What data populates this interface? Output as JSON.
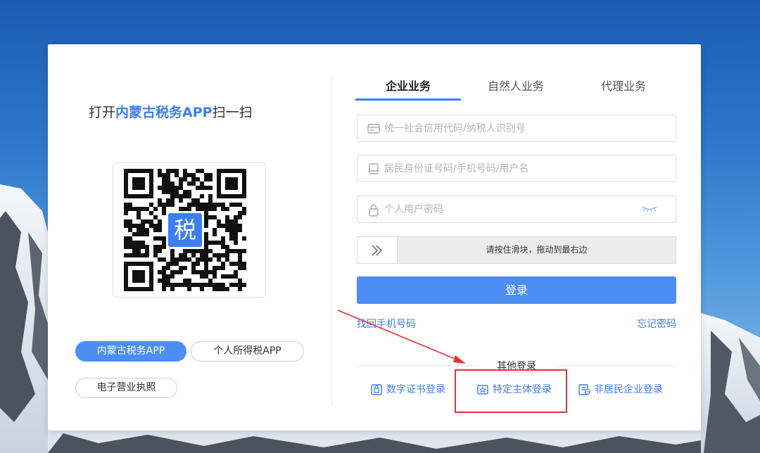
{
  "left": {
    "qr_title_prefix": "打开",
    "qr_title_highlight": "内蒙古税务APP",
    "qr_title_suffix": "扫一扫",
    "qr_center_char": "税",
    "app_buttons": [
      {
        "label": "内蒙古税务APP",
        "active": true
      },
      {
        "label": "个人所得税APP",
        "active": false
      },
      {
        "label": "电子营业执照",
        "active": false
      }
    ]
  },
  "tabs": [
    {
      "label": "企业业务",
      "active": true
    },
    {
      "label": "自然人业务",
      "active": false
    },
    {
      "label": "代理业务",
      "active": false
    }
  ],
  "form": {
    "credit_code_placeholder": "统一社会信用代码/纳税人识别号",
    "account_placeholder": "居民身份证号码/手机号码/用户名",
    "password_placeholder": "个人用户密码",
    "slider_text": "请按住滑块，拖动到最右边",
    "login_label": "登录",
    "retrieve_phone_label": "找回手机号码",
    "forgot_password_label": "忘记密码"
  },
  "other_login": {
    "title": "其他登录",
    "options": [
      {
        "label": "数字证书登录",
        "icon": "certificate-icon"
      },
      {
        "label": "特定主体登录",
        "icon": "special-entity-icon"
      },
      {
        "label": "非居民企业登录",
        "icon": "nonresident-icon"
      }
    ]
  },
  "annotation": {
    "highlight_color": "#e53333",
    "highlighted_option": "特定主体登录"
  },
  "colors": {
    "accent": "#4d8df4",
    "link": "#3d7ff0",
    "annotation": "#e53333"
  }
}
